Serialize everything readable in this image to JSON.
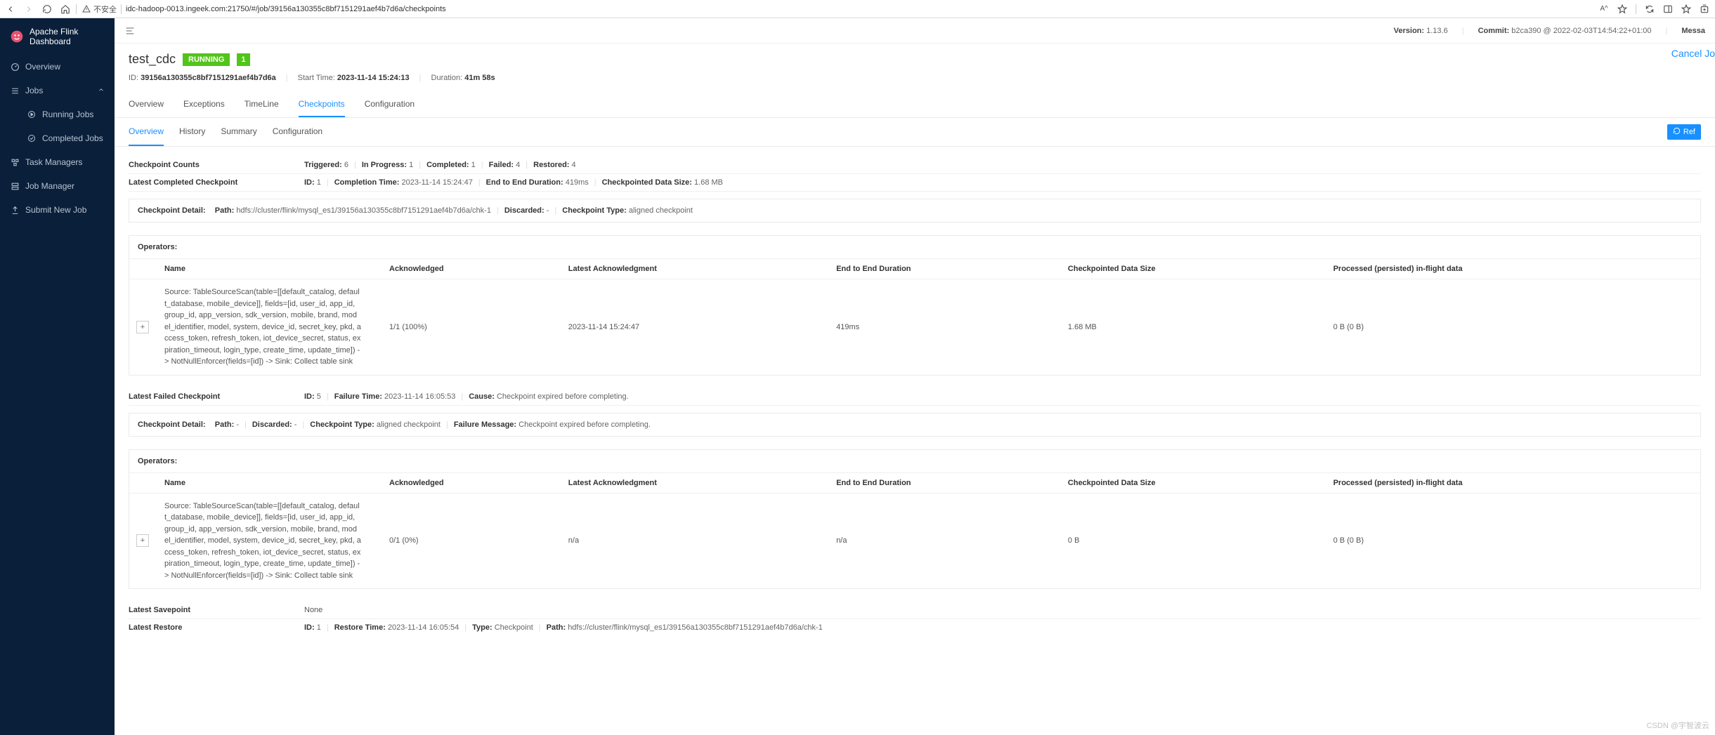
{
  "browser": {
    "insecure_label": "不安全",
    "url": "idc-hadoop-0013.ingeek.com:21750/#/job/39156a130355c8bf7151291aef4b7d6a/checkpoints",
    "aa_label": "A^"
  },
  "sidebar": {
    "title": "Apache Flink Dashboard",
    "items": [
      {
        "icon": "dashboard",
        "label": "Overview"
      },
      {
        "icon": "bars",
        "label": "Jobs",
        "expanded": true,
        "children": [
          {
            "icon": "play",
            "label": "Running Jobs"
          },
          {
            "icon": "check",
            "label": "Completed Jobs"
          }
        ]
      },
      {
        "icon": "cluster",
        "label": "Task Managers"
      },
      {
        "icon": "setting",
        "label": "Job Manager"
      },
      {
        "icon": "upload",
        "label": "Submit New Job"
      }
    ]
  },
  "top_meta": {
    "version_label": "Version:",
    "version": "1.13.6",
    "commit_label": "Commit:",
    "commit": "b2ca390 @ 2022-02-03T14:54:22+01:00",
    "message_label": "Messa"
  },
  "job": {
    "name": "test_cdc",
    "status": "RUNNING",
    "parallelism": "1",
    "id_label": "ID:",
    "id": "39156a130355c8bf7151291aef4b7d6a",
    "start_label": "Start Time:",
    "start": "2023-11-14 15:24:13",
    "duration_label": "Duration:",
    "duration": "41m 58s",
    "cancel": "Cancel Jo"
  },
  "main_tabs": [
    "Overview",
    "Exceptions",
    "TimeLine",
    "Checkpoints",
    "Configuration"
  ],
  "main_tab_active": "Checkpoints",
  "sub_tabs": [
    "Overview",
    "History",
    "Summary",
    "Configuration"
  ],
  "sub_tab_active": "Overview",
  "refresh_label": "Ref",
  "counts": {
    "label": "Checkpoint Counts",
    "triggered_label": "Triggered:",
    "triggered": "6",
    "inprogress_label": "In Progress:",
    "inprogress": "1",
    "completed_label": "Completed:",
    "completed": "1",
    "failed_label": "Failed:",
    "failed": "4",
    "restored_label": "Restored:",
    "restored": "4"
  },
  "latest_completed": {
    "label": "Latest Completed Checkpoint",
    "id_label": "ID:",
    "id": "1",
    "completion_label": "Completion Time:",
    "completion": "2023-11-14 15:24:47",
    "e2e_label": "End to End Duration:",
    "e2e": "419ms",
    "size_label": "Checkpointed Data Size:",
    "size": "1.68 MB",
    "detail": {
      "label": "Checkpoint Detail:",
      "path_label": "Path:",
      "path": "hdfs://cluster/flink/mysql_es1/39156a130355c8bf7151291aef4b7d6a/chk-1",
      "discarded_label": "Discarded:",
      "discarded": "-",
      "type_label": "Checkpoint Type:",
      "type": "aligned checkpoint"
    }
  },
  "operators_header": {
    "title": "Operators:",
    "cols": [
      "Name",
      "Acknowledged",
      "Latest Acknowledgment",
      "End to End Duration",
      "Checkpointed Data Size",
      "Processed (persisted) in-flight data"
    ]
  },
  "operator_completed": {
    "name": "Source: TableSourceScan(table=[[default_catalog, default_database, mobile_device]], fields=[id, user_id, app_id, group_id, app_version, sdk_version, mobile, brand, model_identifier, model, system, device_id, secret_key, pkd, access_token, refresh_token, iot_device_secret, status, expiration_timeout, login_type, create_time, update_time]) -> NotNullEnforcer(fields=[id]) -> Sink: Collect table sink",
    "ack": "1/1 (100%)",
    "latest_ack": "2023-11-14 15:24:47",
    "e2e": "419ms",
    "size": "1.68 MB",
    "inflight": "0 B (0 B)"
  },
  "latest_failed": {
    "label": "Latest Failed Checkpoint",
    "id_label": "ID:",
    "id": "5",
    "failtime_label": "Failure Time:",
    "failtime": "2023-11-14 16:05:53",
    "cause_label": "Cause:",
    "cause": "Checkpoint expired before completing.",
    "detail": {
      "label": "Checkpoint Detail:",
      "path_label": "Path:",
      "path": "-",
      "discarded_label": "Discarded:",
      "discarded": "-",
      "type_label": "Checkpoint Type:",
      "type": "aligned checkpoint",
      "failmsg_label": "Failure Message:",
      "failmsg": "Checkpoint expired before completing."
    }
  },
  "operator_failed": {
    "name": "Source: TableSourceScan(table=[[default_catalog, default_database, mobile_device]], fields=[id, user_id, app_id, group_id, app_version, sdk_version, mobile, brand, model_identifier, model, system, device_id, secret_key, pkd, access_token, refresh_token, iot_device_secret, status, expiration_timeout, login_type, create_time, update_time]) -> NotNullEnforcer(fields=[id]) -> Sink: Collect table sink",
    "ack": "0/1 (0%)",
    "latest_ack": "n/a",
    "e2e": "n/a",
    "size": "0 B",
    "inflight": "0 B (0 B)"
  },
  "latest_savepoint": {
    "label": "Latest Savepoint",
    "value": "None"
  },
  "latest_restore": {
    "label": "Latest Restore",
    "id_label": "ID:",
    "id": "1",
    "restore_label": "Restore Time:",
    "restore": "2023-11-14 16:05:54",
    "type_label": "Type:",
    "type": "Checkpoint",
    "path_label": "Path:",
    "path": "hdfs://cluster/flink/mysql_es1/39156a130355c8bf7151291aef4b7d6a/chk-1"
  },
  "watermark": "CSDN @宇智波云"
}
